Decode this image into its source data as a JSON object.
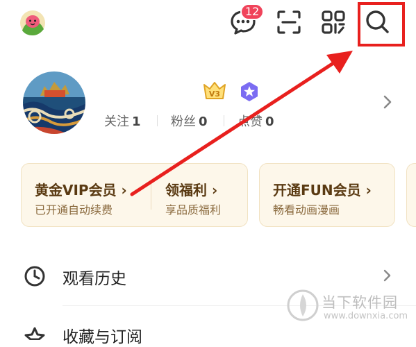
{
  "header": {
    "message_badge": "12",
    "icons": [
      "chat-bubble-icon",
      "scan-icon",
      "qr-code-icon",
      "search-icon"
    ]
  },
  "profile": {
    "following": {
      "label": "关注",
      "value": "1"
    },
    "fans": {
      "label": "粉丝",
      "value": "0"
    },
    "likes": {
      "label": "点赞",
      "value": "0"
    },
    "level_badge_icon": "level-v3-icon",
    "member_badge_icon": "purple-star-icon"
  },
  "vip_cards": {
    "gold_vip": {
      "title": "黄金VIP会员 ›",
      "subtitle": "已开通自动续费"
    },
    "welfare": {
      "title": "领福利 ›",
      "subtitle": "享品质福利"
    },
    "fun_vip": {
      "title": "开通FUN会员 ›",
      "subtitle": "畅看动画漫画"
    }
  },
  "menu": {
    "history": {
      "label": "观看历史"
    },
    "favorites": {
      "label": "收藏与订阅"
    }
  },
  "watermark": {
    "name": "当下软件园",
    "url": "www.downxia.com"
  },
  "colors": {
    "annotation_red": "#e8201e",
    "badge_red": "#f0435a",
    "card_bg": "#fdf7ea",
    "card_text": "#5a3a12"
  }
}
